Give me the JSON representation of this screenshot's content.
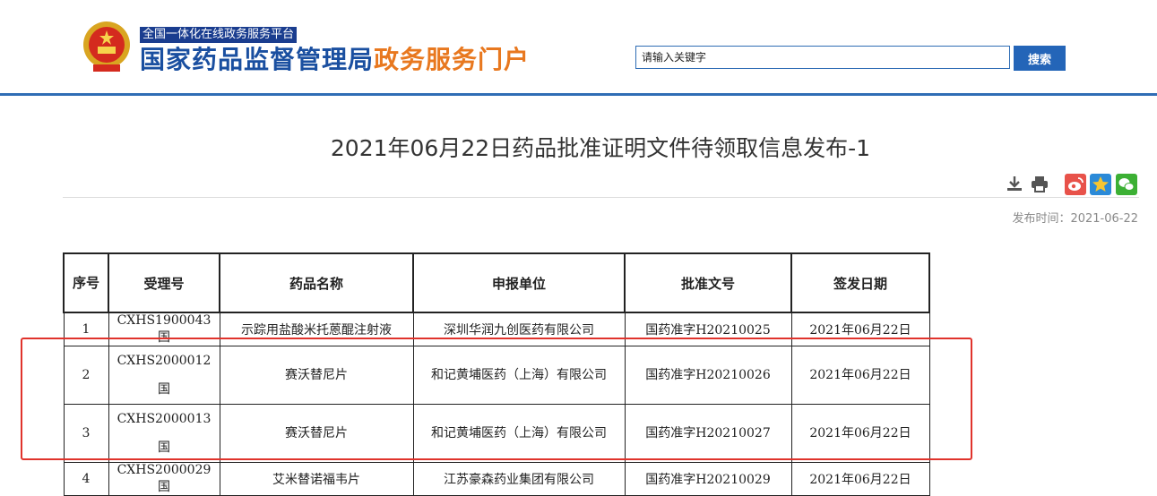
{
  "header": {
    "tagline": "全国一体化在线政务服务平台",
    "brand_part1": "国家药品监督管理局",
    "brand_part2": "政务服务门户",
    "search_placeholder": "请输入关键字",
    "search_button": "搜索"
  },
  "article": {
    "title": "2021年06月22日药品批准证明文件待领取信息发布-1",
    "publish_time": "发布时间：2021-06-22"
  },
  "table": {
    "headers": [
      "序号",
      "受理号",
      "药品名称",
      "申报单位",
      "批准文号",
      "签发日期"
    ],
    "rows": [
      [
        "1",
        "CXHS1900043国",
        "示踪用盐酸米托蒽醌注射液",
        "深圳华润九创医药有限公司",
        "国药准字H20210025",
        "2021年06月22日"
      ],
      [
        "2",
        "CXHS2000012国",
        "赛沃替尼片",
        "和记黄埔医药（上海）有限公司",
        "国药准字H20210026",
        "2021年06月22日"
      ],
      [
        "3",
        "CXHS2000013国",
        "赛沃替尼片",
        "和记黄埔医药（上海）有限公司",
        "国药准字H20210027",
        "2021年06月22日"
      ],
      [
        "4",
        "CXHS2000029国",
        "艾米替诺福韦片",
        "江苏豪森药业集团有限公司",
        "国药准字H20210029",
        "2021年06月22日"
      ]
    ]
  },
  "colors": {
    "brand_blue": "#1a4fa0",
    "brand_orange": "#e8781f",
    "highlight": "#e0332c"
  }
}
